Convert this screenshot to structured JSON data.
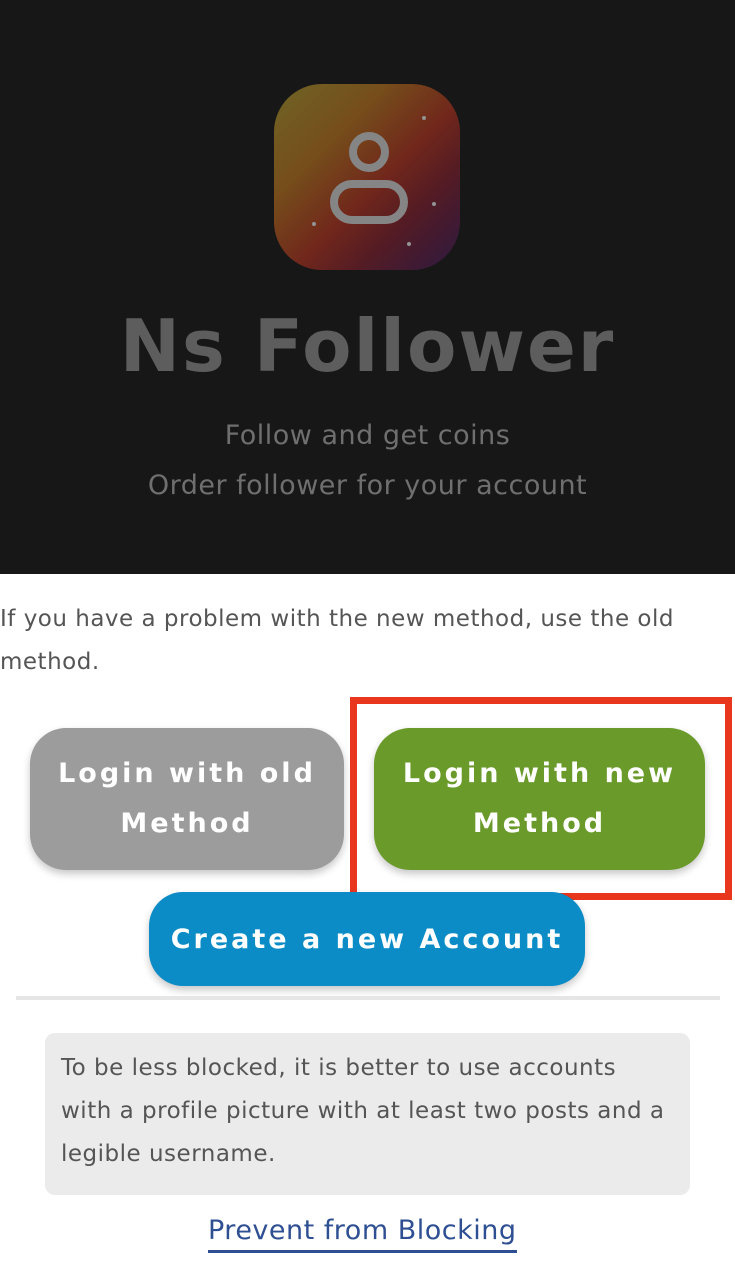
{
  "header": {
    "app_icon": "person-avatar-icon",
    "title": "Ns Follower",
    "subtitle_line1": "Follow and get coins",
    "subtitle_line2": "Order follower for your account"
  },
  "notice": {
    "text": "If you have a problem with the new method, use the old method."
  },
  "buttons": {
    "old_method": "Login with old Method",
    "new_method": "Login with new Method",
    "create_account": "Create a new Account"
  },
  "tip": {
    "text": "To be less blocked, it is better to use accounts with a profile picture with at least two posts and a legible username."
  },
  "link": {
    "prevent_blocking": "Prevent from Blocking"
  },
  "colors": {
    "header_bg": "#171717",
    "old_button": "#9c9c9c",
    "new_button": "#6a9a2a",
    "create_button": "#0b8cc6",
    "highlight": "#e8371d",
    "link": "#2f4f93"
  }
}
